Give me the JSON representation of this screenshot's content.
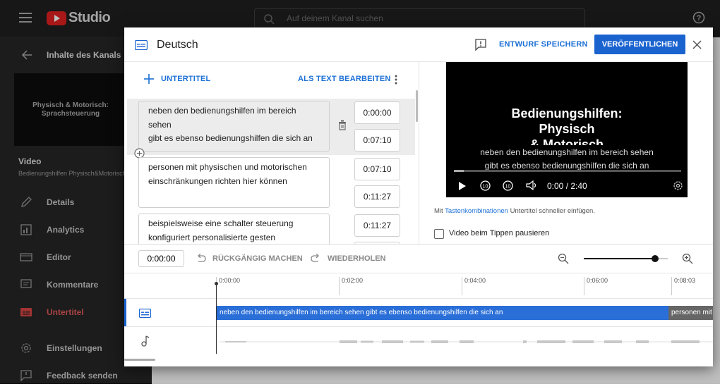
{
  "header": {
    "studio": "Studio",
    "search_placeholder": "Auf deinem Kanal suchen"
  },
  "sidebar": {
    "back_label": "Inhalte des Kanals",
    "thumb_text": "Physisch & Motorisch: Sprachsteuerung",
    "video_heading": "Video",
    "video_name": "Bedienungshilfen Physisch&Motorisch",
    "items": [
      {
        "label": "Details",
        "icon": "pencil-icon"
      },
      {
        "label": "Analytics",
        "icon": "analytics-icon"
      },
      {
        "label": "Editor",
        "icon": "editor-icon"
      },
      {
        "label": "Kommentare",
        "icon": "comment-icon"
      },
      {
        "label": "Untertitel",
        "icon": "subtitles-icon",
        "active": true
      },
      {
        "label": "Einstellungen",
        "icon": "gear-icon"
      },
      {
        "label": "Feedback senden",
        "icon": "feedback-icon"
      }
    ]
  },
  "dialog": {
    "title": "Deutsch",
    "save_draft": "ENTWURF SPEICHERN",
    "publish": "VERÖFFENTLICHEN",
    "add_subtitle": "UNTERTITEL",
    "edit_as_text": "ALS TEXT BEARBEITEN",
    "segments": [
      {
        "lines": [
          "neben den bedienungshilfen im bereich",
          "sehen",
          "gibt es ebenso bedienungshilfen die sich an"
        ],
        "start": "0:00:00",
        "end": "0:07:10"
      },
      {
        "lines": [
          "personen mit physischen und motorischen",
          "einschränkungen richten hier können"
        ],
        "start": "0:07:10",
        "end": "0:11:27"
      },
      {
        "lines": [
          "beispielsweise eine schalter steuerung",
          "konfiguriert personalisierte gesten"
        ],
        "start": "0:11:27",
        "end": ""
      }
    ],
    "player": {
      "title_lines": [
        "Bedienungshilfen:",
        "Physisch",
        "& Motorisch"
      ],
      "caption_lines": [
        "neben den bedienungshilfen im bereich sehen",
        "gibt es ebenso bedienungshilfen die sich an"
      ],
      "time": "0:00 / 2:40"
    },
    "hint_prefix": "Mit",
    "hint_link": "Tastenkombinationen",
    "hint_suffix": "Untertitel schneller einfügen.",
    "pause_label": "Video beim Tippen pausieren",
    "toolbar": {
      "timecode": "0:00:00",
      "undo": "RÜCKGÄNGIG MACHEN",
      "redo": "WIEDERHOLEN",
      "zoom_level": 0.85
    },
    "timeline": {
      "ticks": [
        "0:00:00",
        "0:02:00",
        "0:04:00",
        "0:06:00",
        "0:08:03"
      ],
      "caption_block": "neben den bedienungshilfen im bereich sehen  gibt es ebenso bedienungshilfen die sich an",
      "caption_block_next": "personen mit"
    }
  }
}
